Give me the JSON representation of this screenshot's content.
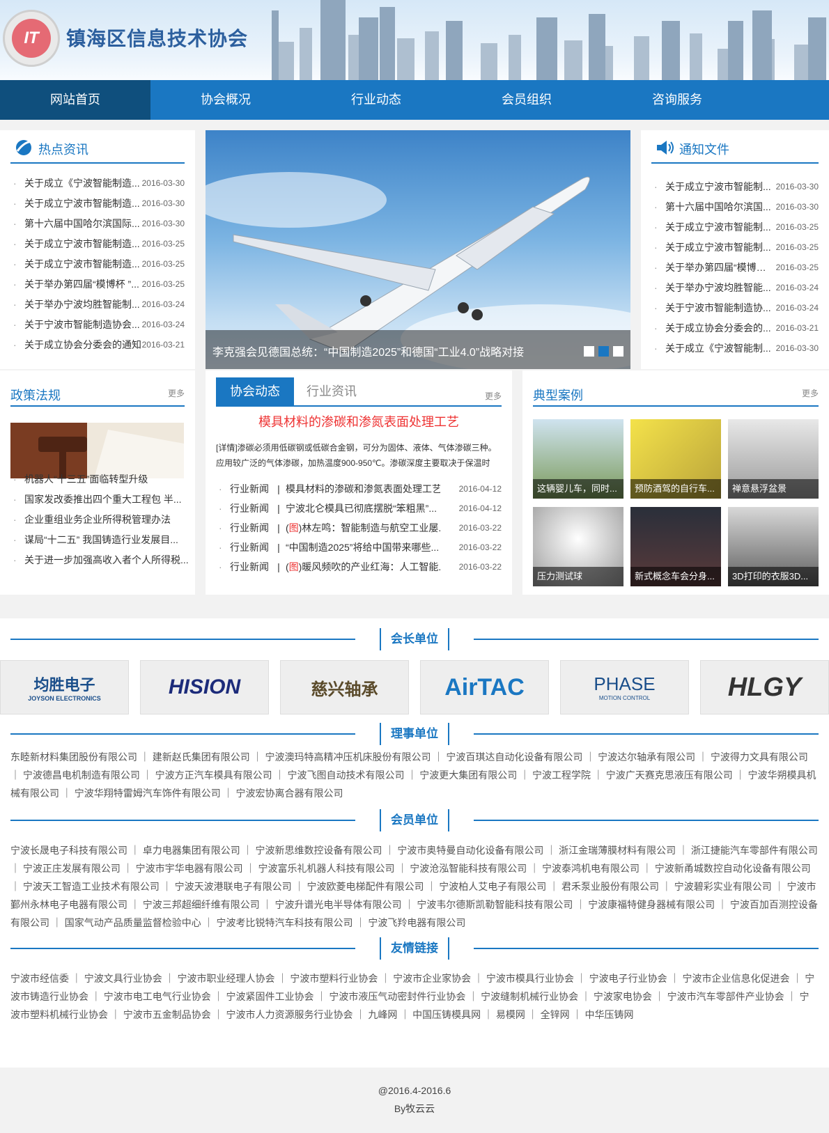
{
  "header": {
    "site_name": "镇海区信息技术协会",
    "logo_text": "IT"
  },
  "nav": {
    "items": [
      "网站首页",
      "协会概况",
      "行业动态",
      "会员组织",
      "咨询服务"
    ]
  },
  "hot_news": {
    "title": "热点资讯",
    "items": [
      {
        "title": "关于成立《宁波智能制造...",
        "date": "2016-03-30"
      },
      {
        "title": "关于成立宁波市智能制造...",
        "date": "2016-03-30"
      },
      {
        "title": "第十六届中国哈尔滨国际...",
        "date": "2016-03-30"
      },
      {
        "title": "关于成立宁波市智能制造...",
        "date": "2016-03-25"
      },
      {
        "title": "关于成立宁波市智能制造...",
        "date": "2016-03-25"
      },
      {
        "title": "关于举办第四届“模博杯 ”...",
        "date": "2016-03-25"
      },
      {
        "title": "关于举办宁波均胜智能制...",
        "date": "2016-03-24"
      },
      {
        "title": "关于宁波市智能制造协会...",
        "date": "2016-03-24"
      },
      {
        "title": "关于成立协会分委会的通知",
        "date": "2016-03-21"
      }
    ]
  },
  "banner": {
    "caption": "李克强会见德国总统：“中国制造2025”和德国“工业4.0”战略对接"
  },
  "notice": {
    "title": "通知文件",
    "items": [
      {
        "title": "关于成立宁波市智能制...",
        "date": "2016-03-30"
      },
      {
        "title": "第十六届中国哈尔滨国...",
        "date": "2016-03-30"
      },
      {
        "title": "关于成立宁波市智能制...",
        "date": "2016-03-25"
      },
      {
        "title": "关于成立宁波市智能制...",
        "date": "2016-03-25"
      },
      {
        "title": "关于举办第四届“模博杯...",
        "date": "2016-03-25"
      },
      {
        "title": "关于举办宁波均胜智能...",
        "date": "2016-03-24"
      },
      {
        "title": "关于宁波市智能制造协...",
        "date": "2016-03-24"
      },
      {
        "title": "关于成立协会分委会的...",
        "date": "2016-03-21"
      },
      {
        "title": "关于成立《宁波智能制...",
        "date": "2016-03-30"
      }
    ]
  },
  "policy": {
    "title": "政策法规",
    "more": "更多",
    "items": [
      "机器人“十三五”面临转型升级",
      "国家发改委推出四个重大工程包 半...",
      "企业重组业务企业所得税管理办法",
      "谋局“十二五” 我国铸造行业发展目...",
      "关于进一步加强高收入者个人所得税..."
    ]
  },
  "dynamics": {
    "tab_active": "协会动态",
    "tab_other": "行业资讯",
    "more": "更多",
    "featured_title": "模具材料的渗碳和渗氮表面处理工艺",
    "featured_body": "[详情]渗碳必须用低碳钢或低碳合金钢，可分为固体、液体、气体渗碳三种。应用较广泛的气体渗碳，加热温度900-950℃。渗碳深度主要取决于保温时",
    "items": [
      {
        "cat": "行业新闻",
        "sep": "|",
        "tag": "",
        "title": "模具材料的渗碳和渗氮表面处理工艺",
        "date": "2016-04-12"
      },
      {
        "cat": "行业新闻",
        "sep": "|",
        "tag": "",
        "title": " 宁波北仑模具已彻底摆脱“笨粗黑”...",
        "date": "2016-04-12"
      },
      {
        "cat": "行业新闻",
        "sep": "|",
        "tag": "图",
        "title": "林左鸣：智能制造与航空工业屡...",
        "date": "2016-03-22"
      },
      {
        "cat": "行业新闻",
        "sep": "|",
        "tag": "",
        "title": "“中国制造2025”将给中国带来哪些...",
        "date": "2016-03-22"
      },
      {
        "cat": "行业新闻",
        "sep": "|",
        "tag": "图",
        "title": "暖风频吹的产业红海：人工智能...",
        "date": "2016-03-22"
      }
    ]
  },
  "cases": {
    "title": "典型案例",
    "more": "更多",
    "items": [
      "这辆婴儿车，同时...",
      "预防酒驾的自行车...",
      "禅意悬浮盆景",
      "压力测试球",
      "新式概念车会分身...",
      "3D打印的衣服3D..."
    ]
  },
  "president_units": {
    "title": "会长单位",
    "logos": [
      "均胜电子",
      "HISION",
      "慈兴轴承",
      "AirTAC",
      "PHASE",
      "HLGY"
    ],
    "logo_sub": {
      "joyson": "JOYSON ELECTRONICS",
      "phase": "MOTION CONTROL"
    }
  },
  "director_units": {
    "title": "理事单位",
    "text": "东睦新材料集团股份有限公司 ｜ 建新赵氏集团有限公司 ｜ 宁波澳玛特高精冲压机床股份有限公司 ｜ 宁波百琪达自动化设备有限公司 ｜ 宁波达尔轴承有限公司 ｜ 宁波得力文具有限公司 ｜ 宁波德昌电机制造有限公司 ｜ 宁波方正汽车模具有限公司 ｜ 宁波飞图自动技术有限公司 ｜ 宁波更大集团有限公司 ｜ 宁波工程学院 ｜ 宁波广天赛克思液压有限公司 ｜ 宁波华朔模具机械有限公司 ｜ 宁波华翔特雷姆汽车饰件有限公司 ｜ 宁波宏协离合器有限公司"
  },
  "member_units": {
    "title": "会员单位",
    "text": "宁波长晟电子科技有限公司 ｜ 卓力电器集团有限公司 ｜ 宁波新思维数控设备有限公司 ｜ 宁波市奥特曼自动化设备有限公司 ｜ 浙江金瑞薄膜材料有限公司 ｜ 浙江捷能汽车零部件有限公司 ｜ 宁波正庄发展有限公司 ｜ 宁波市宇华电器有限公司 ｜ 宁波富乐礼机器人科技有限公司 ｜ 宁波沧泓智能科技有限公司 ｜ 宁波泰鸿机电有限公司 ｜ 宁波新甬城数控自动化设备有限公司 ｜ 宁波天工智造工业技术有限公司 ｜ 宁波天波港联电子有限公司 ｜ 宁波欧菱电梯配件有限公司 ｜ 宁波柏人艾电子有限公司 ｜ 君禾泵业股份有限公司 ｜ 宁波碧彩实业有限公司 ｜ 宁波市鄞州永林电子电器有限公司 ｜ 宁波三邦超细纤维有限公司 ｜ 宁波升谱光电半导体有限公司 ｜ 宁波韦尔德斯凯勒智能科技有限公司 ｜ 宁波康福特健身器械有限公司 ｜ 宁波百加百测控设备有限公司 ｜ 国家气动产品质量监督检验中心 ｜ 宁波考比锐特汽车科技有限公司 ｜ 宁波飞羚电器有限公司"
  },
  "friend_links": {
    "title": "友情链接",
    "text": "宁波市经信委 ｜ 宁波文具行业协会 ｜ 宁波市职业经理人协会 ｜ 宁波市塑料行业协会 ｜ 宁波市企业家协会 ｜ 宁波市模具行业协会 ｜ 宁波电子行业协会 ｜ 宁波市企业信息化促进会 ｜ 宁波市铸造行业协会 ｜ 宁波市电工电气行业协会 ｜ 宁波紧固件工业协会 ｜ 宁波市液压气动密封件行业协会 ｜ 宁波缝制机械行业协会 ｜ 宁波家电协会 ｜ 宁波市汽车零部件产业协会 ｜ 宁波市塑料机械行业协会 ｜ 宁波市五金制品协会 ｜ 宁波市人力资源服务行业协会 ｜ 九峰网 ｜ 中国压铸模具网 ｜ 易模网 ｜ 全锌网 ｜ 中华压铸网"
  },
  "footer": {
    "copyright": "@2016.4-2016.6",
    "by": "By牧云云"
  },
  "colors": {
    "brand": "#1a77c2",
    "nav_active": "#0f4f7d",
    "highlight": "#e33333"
  }
}
